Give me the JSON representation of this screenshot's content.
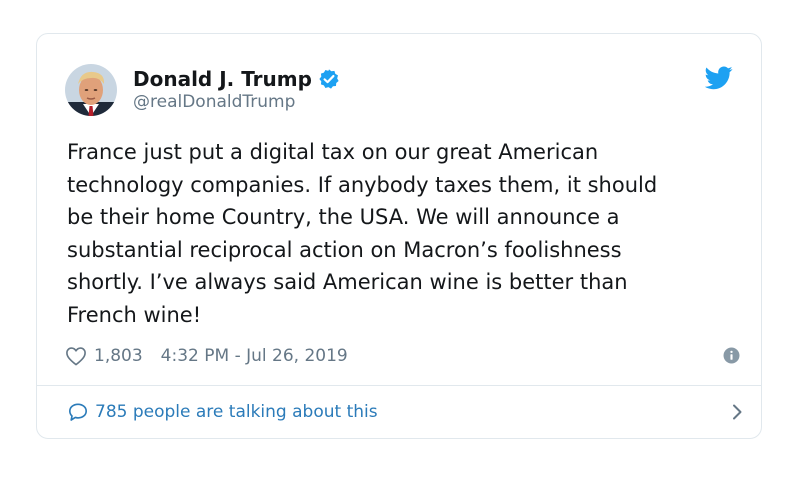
{
  "author": {
    "display_name": "Donald J. Trump",
    "handle": "@realDonaldTrump",
    "verified": true
  },
  "tweet": {
    "text": "France just put a digital tax on our great American\ntechnology companies. If anybody taxes them, it should\nbe their home Country, the USA. We will announce a\nsubstantial reciprocal action on Macron’s foolishness\nshortly. I’ve always said American wine is better than\nFrench wine!",
    "likes": "1,803",
    "timestamp": "4:32 PM - Jul 26, 2019"
  },
  "footer": {
    "conversation_label": "785 people are talking about this"
  },
  "icons": {
    "brand": "twitter-bird-icon",
    "verified": "verified-badge-icon",
    "like": "heart-icon",
    "info": "info-icon",
    "reply": "speech-bubble-icon",
    "more": "chevron-right-icon"
  },
  "colors": {
    "brand_blue": "#1da1f2",
    "link_blue": "#2b7bb9",
    "text_primary": "#14171a",
    "text_secondary": "#657786",
    "border": "#e1e8ed"
  }
}
